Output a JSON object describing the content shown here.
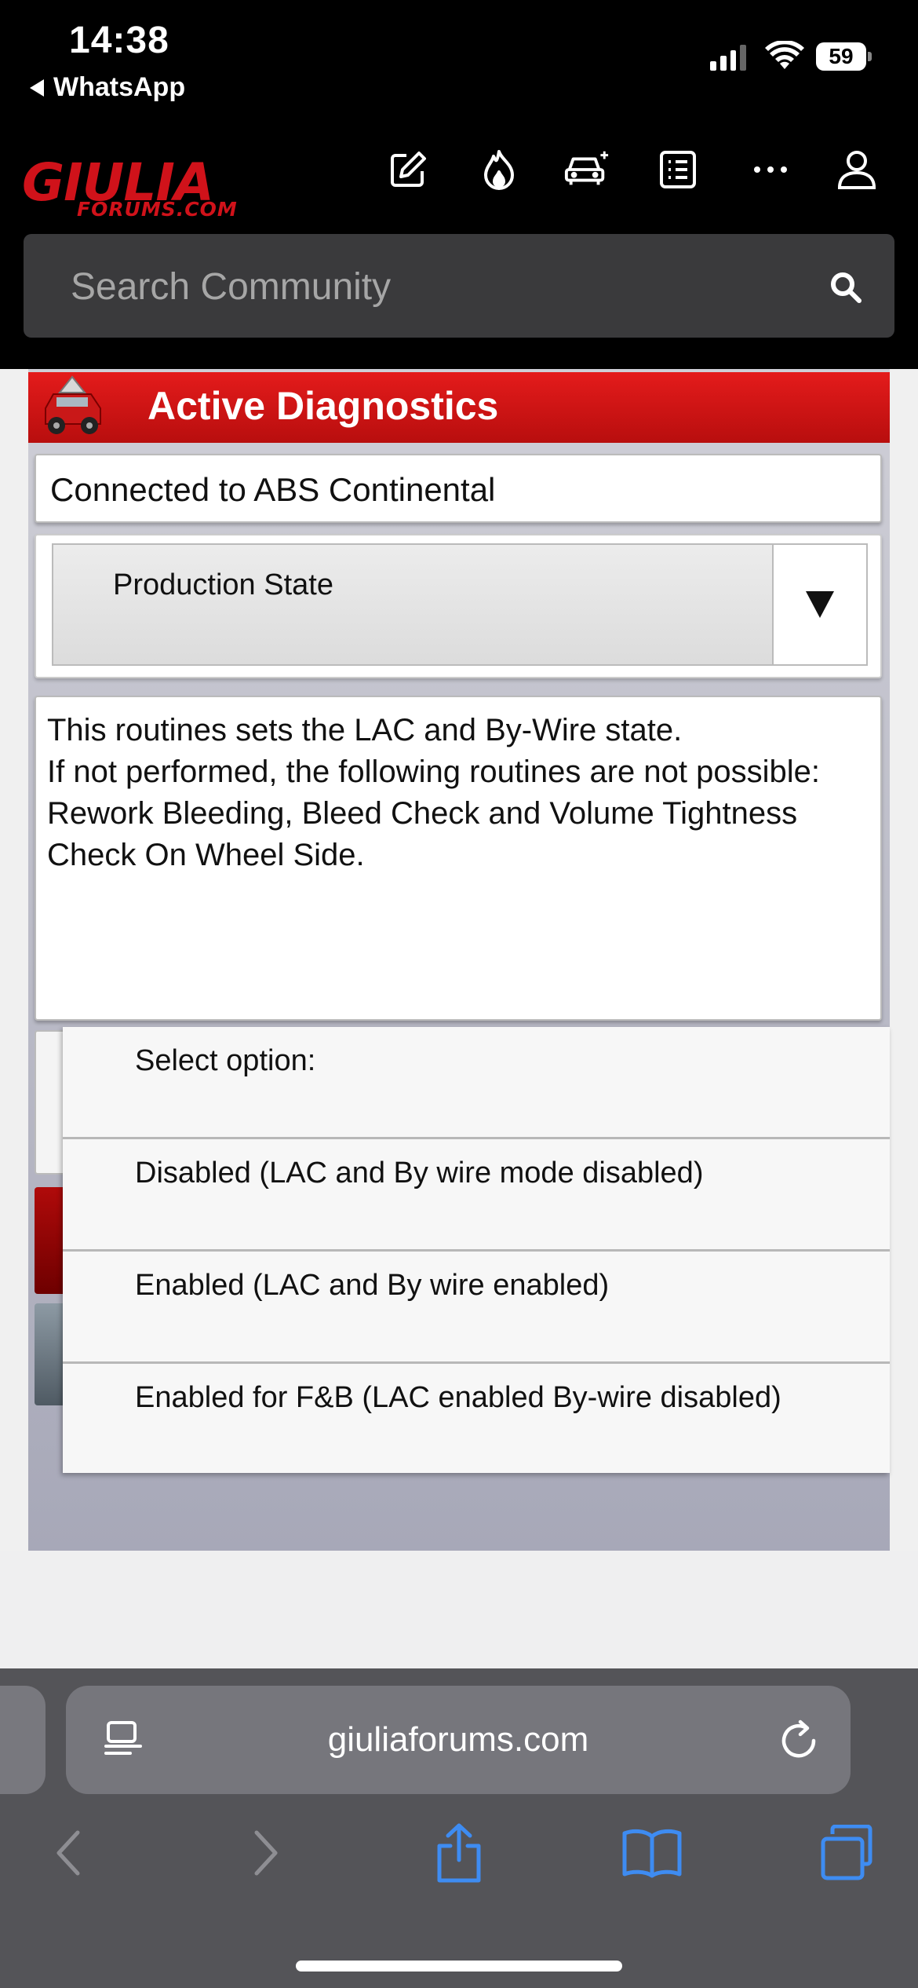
{
  "status_bar": {
    "time": "14:38",
    "back_app": "WhatsApp",
    "battery": "59"
  },
  "forum": {
    "logo_main": "GIULIA",
    "logo_sub": "FORUMS.COM",
    "search_placeholder": "Search Community",
    "header_icons": [
      "compose-icon",
      "flame-icon",
      "car-add-icon",
      "list-icon",
      "more-icon",
      "user-icon"
    ]
  },
  "app": {
    "title": "Active Diagnostics",
    "connection": "Connected to ABS Continental",
    "dropdown_value": "Production State",
    "description": "This routines sets the LAC and By-Wire state.\nIf not performed, the following routines are not possible: Rework Bleeding, Bleed Check and Volume Tightness Check On Wheel Side.",
    "select_title": "Select option:",
    "options": [
      "Disabled (LAC and By wire mode disabled)",
      "Enabled (LAC and By wire enabled)",
      "Enabled for F&B (LAC enabled  By-wire disabled)"
    ]
  },
  "browser": {
    "url": "giuliaforums.com",
    "accent_color": "#3e8cf2",
    "disabled_color": "#8e8e93"
  }
}
